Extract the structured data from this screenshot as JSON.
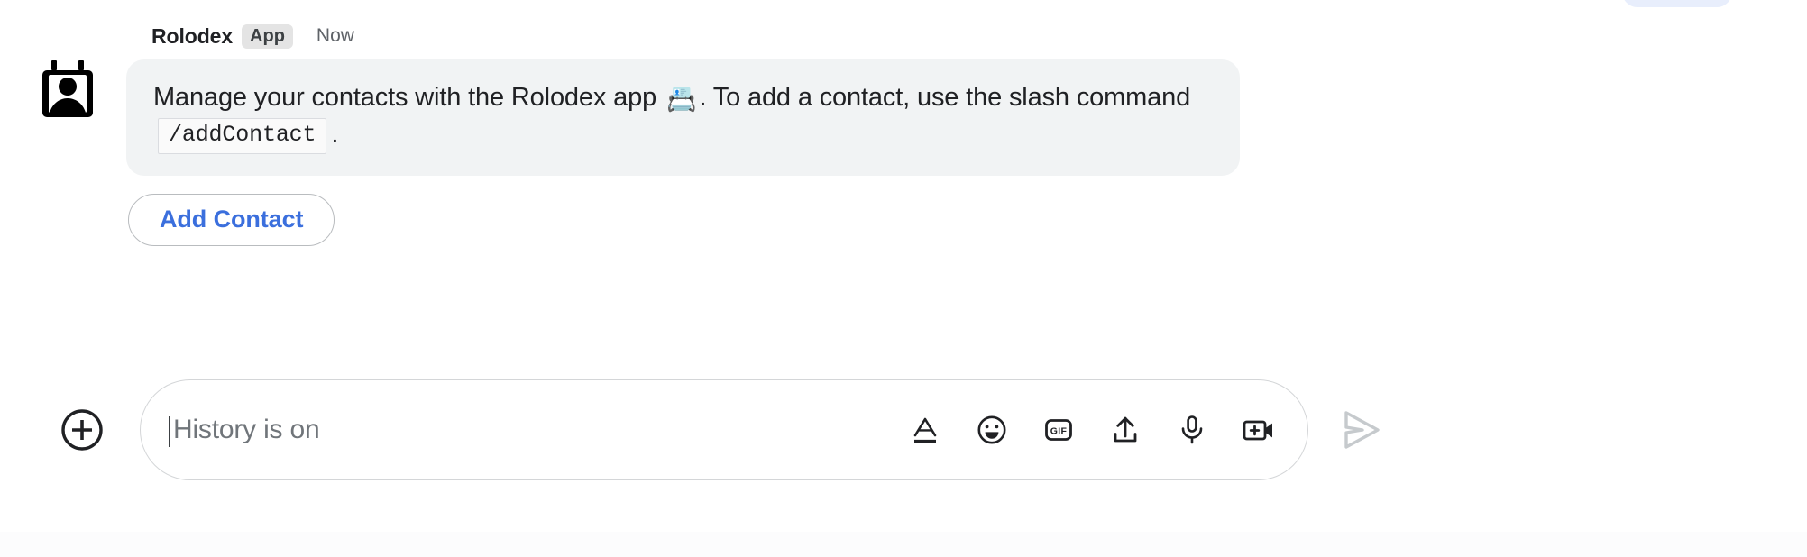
{
  "message": {
    "sender_name": "Rolodex",
    "app_badge": "App",
    "timestamp": "Now",
    "avatar_icon": "rolodex-contact-card-icon",
    "bubble": {
      "text_before_emoji": "Manage your contacts with the Rolodex app ",
      "emoji": "📇",
      "text_after_emoji": ". To add a contact, use the slash command ",
      "code": "/addContact",
      "text_end": "."
    },
    "action_button_label": "Add Contact",
    "action_button_color": "#3b6fdd"
  },
  "composer": {
    "add_button_icon": "plus-circle-icon",
    "placeholder": "History is on",
    "input_value": "",
    "tools": [
      {
        "name": "format-text-icon",
        "label": "Format text"
      },
      {
        "name": "emoji-icon",
        "label": "Insert emoji"
      },
      {
        "name": "gif-icon",
        "label": "GIF"
      },
      {
        "name": "upload-icon",
        "label": "Upload file"
      },
      {
        "name": "microphone-icon",
        "label": "Voice message"
      },
      {
        "name": "video-add-icon",
        "label": "Add video meeting"
      }
    ],
    "send_icon": "send-arrow-icon",
    "send_enabled": false
  },
  "colors": {
    "bubble_bg": "#f1f3f4",
    "badge_bg": "#e4e4e4",
    "accent_blue": "#3b6fdd",
    "placeholder_text": "#70757a",
    "send_disabled": "#c6cacd",
    "top_chip": "#e8eefc"
  }
}
